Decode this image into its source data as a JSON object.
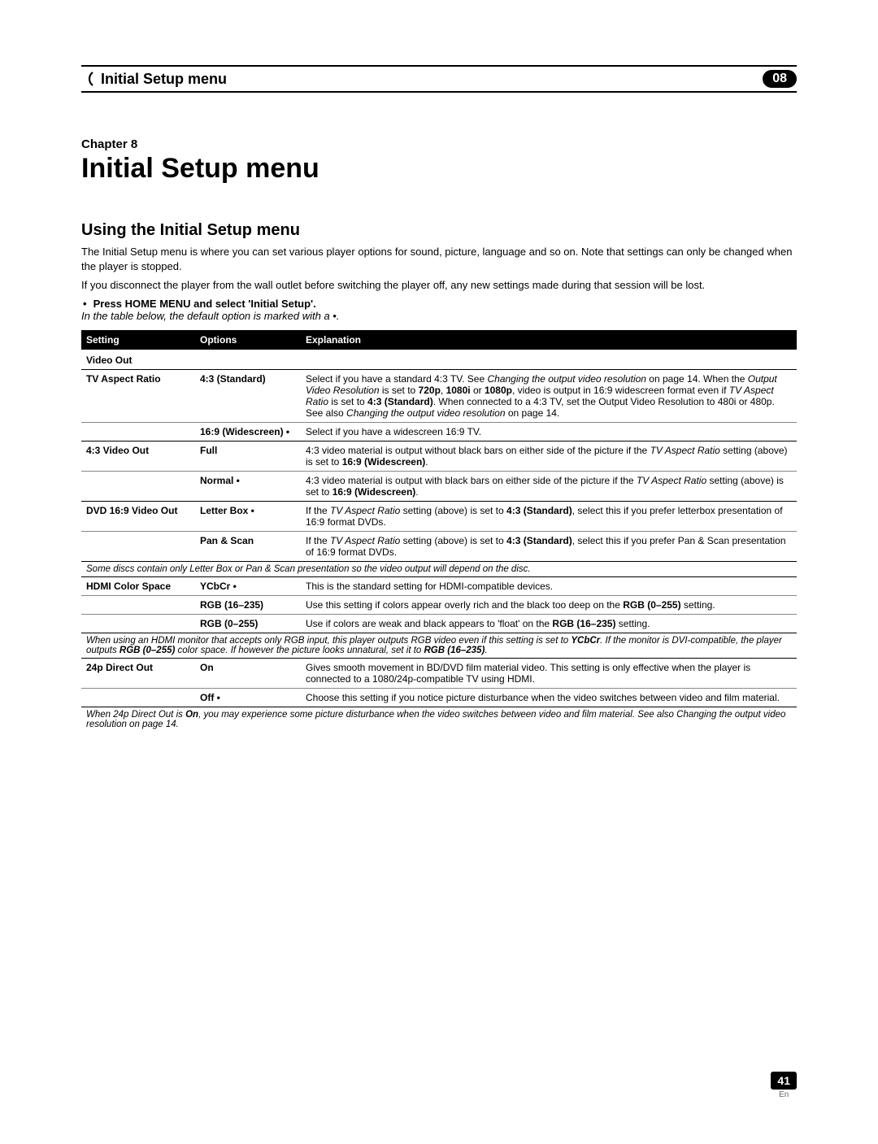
{
  "header": {
    "title": "Initial Setup menu",
    "chapter_badge": "08"
  },
  "chapter": {
    "label": "Chapter 8",
    "title": "Initial Setup menu"
  },
  "section": {
    "title": "Using the Initial Setup menu",
    "p1": "The Initial Setup menu is where you can set various player options for sound, picture, language and so on. Note that settings can only be changed when the player is stopped.",
    "p2": "If you disconnect the player from the wall outlet before switching the player off, any new settings made during that session will be lost.",
    "bullet": "Press HOME MENU and select 'Initial Setup'.",
    "note": "In the table below, the default option is marked with a •."
  },
  "table": {
    "headers": {
      "c1": "Setting",
      "c2": "Options",
      "c3": "Explanation"
    },
    "video_out_label": "Video Out",
    "rows": {
      "tv_aspect": {
        "setting": "TV Aspect Ratio",
        "opt1": "4:3 (Standard)",
        "exp1a": "Select if you have a standard 4:3 TV. See ",
        "exp1b": "Changing the output video resolution",
        "exp1c": " on page 14. When the ",
        "exp1d": "Output Video Resolution",
        "exp1e": " is set to ",
        "exp1f": "720p",
        "exp1g": ", ",
        "exp1h": "1080i",
        "exp1i": " or ",
        "exp1j": "1080p",
        "exp1k": ", video is output in 16:9 widescreen format even if ",
        "exp1l": "TV Aspect Ratio",
        "exp1m": " is set to ",
        "exp1n": "4:3 (Standard)",
        "exp1o": ". When connected to a 4:3 TV, set the Output Video Resolution to 480i or 480p. See also ",
        "exp1p": "Changing the output video resolution",
        "exp1q": " on page 14.",
        "opt2": "16:9 (Widescreen) •",
        "exp2": "Select if you have a widescreen 16:9 TV."
      },
      "v43": {
        "setting": "4:3 Video Out",
        "opt1": "Full",
        "exp1a": "4:3 video material is output without black bars on either side of the picture if the ",
        "exp1b": "TV Aspect Ratio",
        "exp1c": " setting (above) is set to ",
        "exp1d": "16:9 (Widescreen)",
        "exp1e": ".",
        "opt2": "Normal •",
        "exp2a": "4:3 video material is output with black bars on either side of the picture if the ",
        "exp2b": "TV Aspect Ratio",
        "exp2c": " setting (above) is set to ",
        "exp2d": "16:9 (Widescreen)",
        "exp2e": "."
      },
      "dvd169": {
        "setting": "DVD 16:9 Video Out",
        "opt1": "Letter Box •",
        "exp1a": "If the ",
        "exp1b": "TV Aspect Ratio",
        "exp1c": " setting (above) is set to ",
        "exp1d": "4:3 (Standard)",
        "exp1e": ", select this if you prefer letterbox presentation of 16:9 format DVDs.",
        "opt2": "Pan & Scan",
        "exp2a": "If the ",
        "exp2b": "TV Aspect Ratio",
        "exp2c": " setting (above) is set to ",
        "exp2d": "4:3 (Standard)",
        "exp2e": ", select this if you prefer Pan & Scan presentation of 16:9 format DVDs."
      },
      "footnote_disc": "Some discs contain only Letter Box or Pan & Scan presentation so the video output will depend on the disc.",
      "hdmi": {
        "setting": "HDMI Color Space",
        "opt1": "YCbCr •",
        "exp1": "This is the standard setting for HDMI-compatible devices.",
        "opt2": "RGB (16–235)",
        "exp2a": "Use this setting if colors appear overly rich and the black too deep on the ",
        "exp2b": "RGB (0–255)",
        "exp2c": " setting.",
        "opt3": "RGB (0–255)",
        "exp3a": "Use if colors are weak and black appears to 'float' on the ",
        "exp3b": "RGB (16–235)",
        "exp3c": " setting."
      },
      "footnote_hdmi_a": "When using an HDMI monitor that accepts only RGB input, this player outputs RGB video even if this setting is set to ",
      "footnote_hdmi_b": "YCbCr",
      "footnote_hdmi_c": ". If the monitor is DVI-compatible, the player outputs ",
      "footnote_hdmi_d": "RGB (0–255)",
      "footnote_hdmi_e": " color space. If however the picture looks unnatural, set it to ",
      "footnote_hdmi_f": "RGB (16–235)",
      "footnote_hdmi_g": ".",
      "p24": {
        "setting": "24p Direct Out",
        "opt1": "On",
        "exp1": "Gives smooth movement in BD/DVD film material video. This setting is only effective when the player is connected to a 1080/24p-compatible TV using HDMI.",
        "opt2": "Off •",
        "exp2": "Choose this setting if you notice picture disturbance when the video switches between video and film material."
      },
      "footnote_24p_a": "When 24p Direct Out is ",
      "footnote_24p_b": "On",
      "footnote_24p_c": ", you may experience some picture disturbance when the video switches between video and film material. See also Changing the output video resolution on page 14."
    }
  },
  "footer": {
    "page": "41",
    "lang": "En"
  }
}
